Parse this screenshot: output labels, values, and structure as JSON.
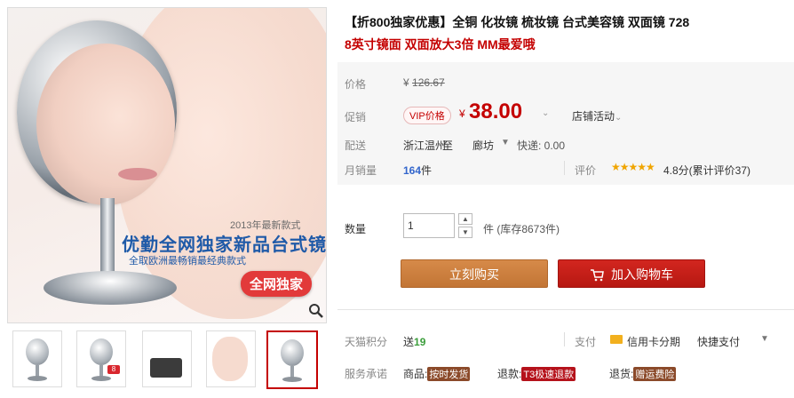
{
  "gallery": {
    "main_image": {
      "year_text": "2013年最新款式",
      "headline": "优勤全网独家新品台式镜",
      "subline": "全取欧洲最畅销最经典款式",
      "badge": "全网独家"
    },
    "thumbnails": [
      {
        "name": "thumb-mirror-front"
      },
      {
        "name": "thumb-mirror-8x"
      },
      {
        "name": "thumb-cosmetics"
      },
      {
        "name": "thumb-face-closeup"
      },
      {
        "name": "thumb-mirror-selected"
      }
    ],
    "thumb_badge": "8"
  },
  "product": {
    "title": "【折800独家优惠】全铜 化妆镜 梳妆镜 台式美容镜 双面镜 728",
    "subtitle": "8英寸镜面 双面放大3倍 MM最爱哦"
  },
  "pricing": {
    "price_label": "价格",
    "original_currency": "¥",
    "original_price": "126.67",
    "promo_label": "促销",
    "vip_tag": "VIP价格",
    "promo_currency": "¥",
    "promo_price": "38.00",
    "store_activity": "店铺活动",
    "delivery_label": "配送",
    "delivery_from": "浙江温州",
    "delivery_to": "至",
    "delivery_city": "廊坊",
    "delivery_fee": "快递: 0.00",
    "monthly_label": "月销量",
    "monthly_count": "164",
    "monthly_unit": "件",
    "rating_label": "评价",
    "rating_stars": "★★★★★",
    "rating_text": "4.8分(累计评价37)"
  },
  "purchase": {
    "qty_label": "数量",
    "qty_value": "1",
    "qty_unit": "件 (库存8673件)",
    "buy_now": "立刻购买",
    "add_to_cart": "加入购物车"
  },
  "extras": {
    "points_label": "天猫积分",
    "points_prefix": "送",
    "points_value": "19",
    "pay_label": "支付",
    "card_pay": "信用卡分期",
    "quick_pay": "快捷支付",
    "service_label": "服务承诺",
    "svc1_prefix": "商品:",
    "svc1_tag": "按时发货",
    "svc2_prefix": "退款:",
    "svc2_tag": "T3极速退款",
    "svc3_prefix": "退货:",
    "svc3_tag": "赠运费险"
  },
  "colors": {
    "accent_red": "#c40000",
    "buy_button": "#c27535",
    "cart_button": "#b71812",
    "price_area_bg": "#f6f6f6"
  }
}
